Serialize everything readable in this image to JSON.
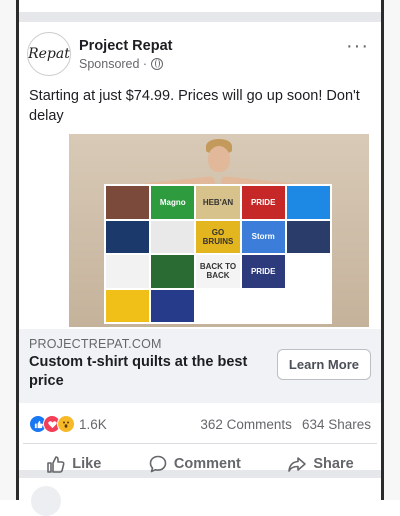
{
  "post": {
    "page_name": "Project Repat",
    "avatar_text": "Repat",
    "sponsored": "Sponsored ·",
    "text": "Starting at just $74.99. Prices will go up soon! Don't delay",
    "more_icon": "···"
  },
  "media": {
    "quilt_tiles": [
      {
        "label": "",
        "color": "#7c4a3a"
      },
      {
        "label": "Magno",
        "color": "#2e9b3f"
      },
      {
        "label": "HEB'AN",
        "color": "#d8c28c"
      },
      {
        "label": "PRIDE",
        "color": "#c62828"
      },
      {
        "label": "",
        "color": "#1e88e5"
      },
      {
        "label": "",
        "color": "#1b3a6b"
      },
      {
        "label": "",
        "color": "#e9e9e9"
      },
      {
        "label": "GO BRUINS",
        "color": "#e3b51f"
      },
      {
        "label": "Storm",
        "color": "#3b7dd8"
      },
      {
        "label": "",
        "color": "#2a3c6a"
      },
      {
        "label": "",
        "color": "#f2f2f2"
      },
      {
        "label": "",
        "color": "#2a6b33"
      },
      {
        "label": "BACK TO BACK",
        "color": "#f4f4f4"
      },
      {
        "label": "PRIDE",
        "color": "#2d3a7c"
      },
      {
        "label": "",
        "color": "#ffffff"
      },
      {
        "label": "",
        "color": "#f0c019"
      },
      {
        "label": "",
        "color": "#263b8a"
      },
      {
        "label": "",
        "color": "#ffffff"
      },
      {
        "label": "",
        "color": "#ffffff"
      },
      {
        "label": "",
        "color": "#ffffff"
      }
    ]
  },
  "link": {
    "domain": "PROJECTREPAT.COM",
    "title": "Custom t-shirt quilts at the best price",
    "button": "Learn More"
  },
  "engagement": {
    "reaction_count": "1.6K",
    "comments": "362 Comments",
    "shares": "634 Shares"
  },
  "actions": {
    "like": "Like",
    "comment": "Comment",
    "share": "Share"
  }
}
